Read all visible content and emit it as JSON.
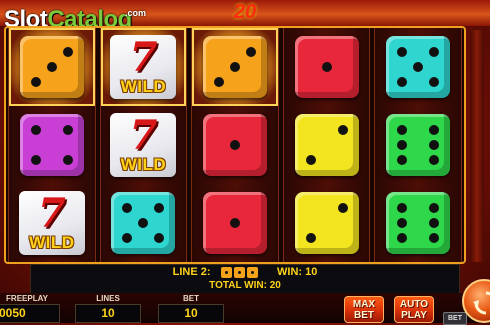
{
  "logo": {
    "part1": "Slot",
    "part2": "Catalog",
    "suffix": ".com"
  },
  "bet_display": "20",
  "reels": [
    [
      {
        "type": "die",
        "color": "#f7a21b",
        "pips": 3,
        "win": true
      },
      {
        "type": "die",
        "color": "#c93fd6",
        "pips": 4,
        "win": false
      },
      {
        "type": "wild",
        "seven": "7",
        "label": "WILD",
        "win": false
      }
    ],
    [
      {
        "type": "wild",
        "seven": "7",
        "label": "WILD",
        "win": true
      },
      {
        "type": "wild",
        "seven": "7",
        "label": "WILD",
        "win": false
      },
      {
        "type": "die",
        "color": "#2fd6d0",
        "pips": 5,
        "win": false
      }
    ],
    [
      {
        "type": "die",
        "color": "#f7a21b",
        "pips": 3,
        "win": true
      },
      {
        "type": "die",
        "color": "#e8283a",
        "pips": 1,
        "win": false
      },
      {
        "type": "die",
        "color": "#e8283a",
        "pips": 1,
        "win": false
      }
    ],
    [
      {
        "type": "die",
        "color": "#e8283a",
        "pips": 1,
        "win": false
      },
      {
        "type": "die",
        "color": "#f2e41e",
        "pips": 2,
        "win": false
      },
      {
        "type": "die",
        "color": "#f2e41e",
        "pips": 2,
        "win": false
      }
    ],
    [
      {
        "type": "die",
        "color": "#2fd6d0",
        "pips": 5,
        "win": false
      },
      {
        "type": "die",
        "color": "#2ed84a",
        "pips": 6,
        "win": false
      },
      {
        "type": "die",
        "color": "#2ed84a",
        "pips": 6,
        "win": false
      }
    ]
  ],
  "win_panel": {
    "line_label": "LINE 2:",
    "win_label": "WIN: 10",
    "total_label": "TOTAL WIN: 20"
  },
  "bottom": {
    "freeplay_label": "FREEPLAY",
    "freeplay_value": "0050",
    "lines_label": "LINES",
    "lines_value": "10",
    "bet_label": "BET",
    "bet_value": "10"
  },
  "buttons": {
    "max_bet_1": "MAX",
    "max_bet_2": "BET",
    "auto_play_1": "AUTO",
    "auto_play_2": "PLAY",
    "bet_small": "BET"
  },
  "colors": {
    "accent": "#ffd21a",
    "win_frame": "#ffd35a",
    "panel_bg": "#0c0c10"
  }
}
